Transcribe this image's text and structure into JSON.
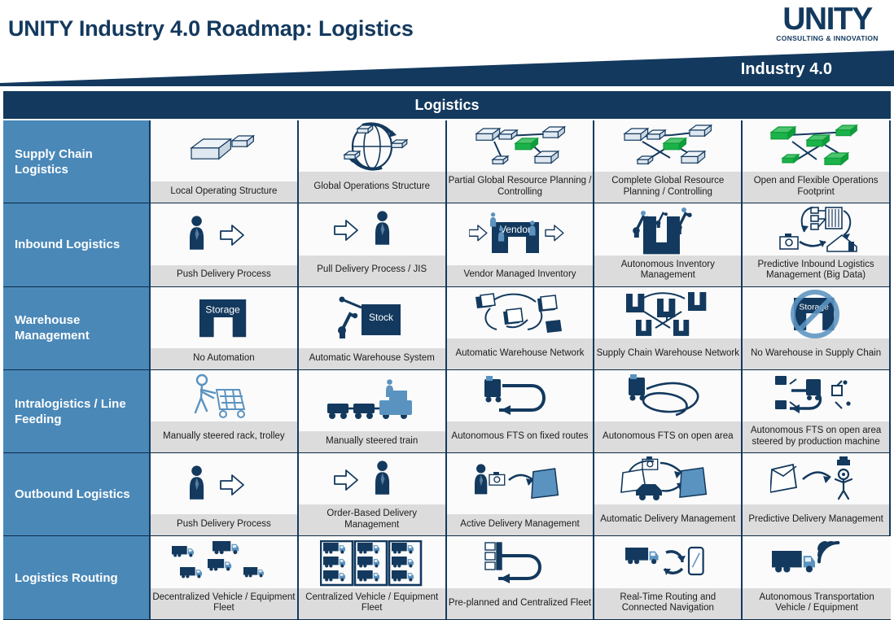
{
  "header": {
    "title": "UNITY Industry 4.0 Roadmap: Logistics",
    "logo_word": "UNITY",
    "logo_tagline": "CONSULTING & INNOVATION",
    "maturity_label": "Industry 4.0",
    "section_title": "Logistics",
    "colors": {
      "dark_blue": "#13395e",
      "mid_blue": "#4a88b8",
      "caption_gray": "#dcdcdc",
      "cell_white": "#fbfbfb",
      "accent_green": "#0f9d3a"
    }
  },
  "rows": [
    {
      "label": "Supply Chain Logistics",
      "cells": [
        {
          "caption": "Local Operating Structure",
          "icon": "single-server-box-icon"
        },
        {
          "caption": "Global Operations Structure",
          "icon": "globe-with-servers-icon"
        },
        {
          "caption": "Partial Global Resource Planning / Controlling",
          "icon": "partial-server-network-icon"
        },
        {
          "caption": "Complete Global Resource Planning / Controlling",
          "icon": "complete-server-network-icon"
        },
        {
          "caption": "Open and Flexible Operations Footprint",
          "icon": "green-server-network-icon"
        }
      ]
    },
    {
      "label": "Inbound Logistics",
      "cells": [
        {
          "caption": "Push Delivery Process",
          "icon": "person-arrow-right-icon"
        },
        {
          "caption": "Pull Delivery Process / JIS",
          "icon": "arrow-right-person-icon"
        },
        {
          "caption": "Vendor Managed Inventory",
          "icon": "vendor-warehouse-icon"
        },
        {
          "caption": "Autonomous Inventory Management",
          "icon": "robot-warehouse-icon"
        },
        {
          "caption": "Predictive Inbound Logistics Management (Big Data)",
          "icon": "predictive-data-flow-icon"
        }
      ]
    },
    {
      "label": "Warehouse Management",
      "cells": [
        {
          "caption": "No Automation",
          "icon": "storage-building-icon",
          "icon_text": "Storage"
        },
        {
          "caption": "Automatic Warehouse System",
          "icon": "robot-stock-icon",
          "icon_text": "Stock"
        },
        {
          "caption": "Automatic Warehouse Network",
          "icon": "warehouse-network-icon"
        },
        {
          "caption": "Supply Chain Warehouse Network",
          "icon": "supply-chain-network-icon"
        },
        {
          "caption": "No Warehouse in Supply Chain",
          "icon": "no-storage-prohibited-icon",
          "icon_text": "Storage"
        }
      ]
    },
    {
      "label": "Intralogistics / Line Feeding",
      "cells": [
        {
          "caption": "Manually steered rack, trolley",
          "icon": "person-pushing-trolley-icon"
        },
        {
          "caption": "Manually  steered train",
          "icon": "tugger-train-icon"
        },
        {
          "caption": "Autonomous FTS on fixed routes",
          "icon": "agv-fixed-route-icon"
        },
        {
          "caption": "Autonomous FTS on open area",
          "icon": "agv-open-area-icon"
        },
        {
          "caption": "Autonomous FTS on open area steered by production machine",
          "icon": "agv-machine-steered-icon"
        }
      ]
    },
    {
      "label": "Outbound Logistics",
      "cells": [
        {
          "caption": "Push Delivery Process",
          "icon": "person-arrow-right-icon"
        },
        {
          "caption": "Order-Based Delivery Management",
          "icon": "arrow-right-person-icon"
        },
        {
          "caption": "Active Delivery Management",
          "icon": "person-package-delivery-icon"
        },
        {
          "caption": "Automatic Delivery Management",
          "icon": "automatic-delivery-icon"
        },
        {
          "caption": "Predictive Delivery Management",
          "icon": "predictive-delivery-icon"
        }
      ]
    },
    {
      "label": "Logistics Routing",
      "cells": [
        {
          "caption": "Decentralized Vehicle / Equipment Fleet",
          "icon": "scattered-trucks-icon"
        },
        {
          "caption": "Centralized Vehicle / Equipment Fleet",
          "icon": "grouped-trucks-icon"
        },
        {
          "caption": "Pre-planned and Centralized Fleet",
          "icon": "preplanned-route-icon"
        },
        {
          "caption": "Real-Time Routing and Connected Navigation",
          "icon": "truck-smartphone-icon"
        },
        {
          "caption": "Autonomous Transportation Vehicle / Equipment",
          "icon": "autonomous-truck-signal-icon"
        }
      ]
    }
  ]
}
